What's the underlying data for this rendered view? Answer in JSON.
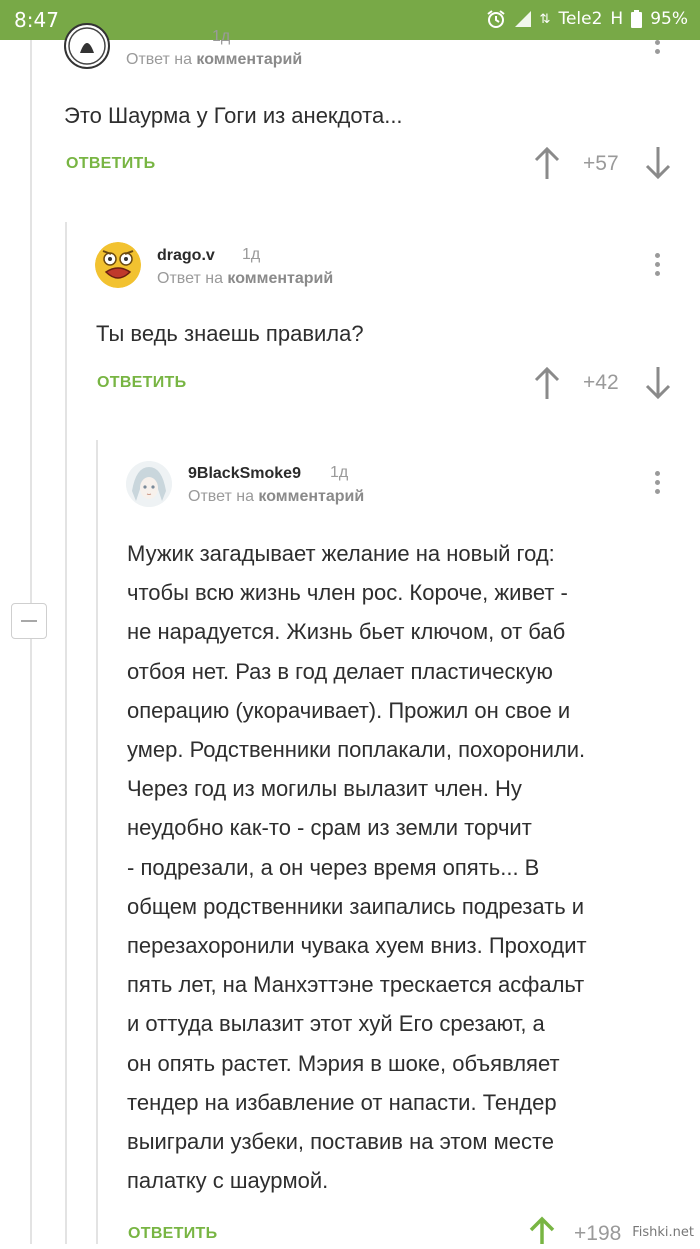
{
  "status_bar": {
    "time": "8:47",
    "carrier": "Tele2",
    "network": "H",
    "battery": "95%",
    "icons": [
      "alarm-icon",
      "signal-icon",
      "battery-icon"
    ]
  },
  "colors": {
    "status_bar": "#78a947",
    "accent_green": "#78b543",
    "muted": "#9a9a9a"
  },
  "comments": [
    {
      "author": "",
      "time": "1д",
      "reply_prefix": "Ответ на",
      "reply_target": "комментарий",
      "text": "Это Шаурма у Гоги из анекдота...",
      "reply_label": "ОТВЕТИТЬ",
      "rating": "+57"
    },
    {
      "author": "drago.v",
      "time": "1д",
      "reply_prefix": "Ответ на",
      "reply_target": "комментарий",
      "text": "Ты ведь знаешь правила?",
      "reply_label": "ОТВЕТИТЬ",
      "rating": "+42"
    },
    {
      "author": "9BlackSmoke9",
      "time": "1д",
      "reply_prefix": "Ответ на",
      "reply_target": "комментарий",
      "text_lines": [
        "Мужик загадывает желание на новый год:",
        "чтобы всю жизнь член рос. Короче, живет -",
        "не нарадуется. Жизнь бьет ключом, от баб",
        "отбоя нет. Раз в год делает пластическую",
        "операцию (укорачивает). Прожил он свое и",
        "умер. Родственники поплакали, похоронили.",
        "Через год из могилы вылазит член. Ну",
        "неудобно как-то - срам из земли торчит",
        "- подрезали, а он через время опять... В",
        "общем родственники заипались подрезать и",
        "перезахоронили чувака хуем вниз. Проходит",
        "пять лет, на Манхэттэне трескается асфальт",
        "и оттуда вылазит этот хуй Его срезают, а",
        "он опять растет. Мэрия в шоке, объявляет",
        "тендер на избавление от напасти. Тендер",
        "выиграли узбеки, поставив на этом месте",
        "палатку с шаурмой."
      ],
      "reply_label": "ОТВЕТИТЬ",
      "rating": "+198"
    }
  ],
  "watermark": "Fishki.net"
}
